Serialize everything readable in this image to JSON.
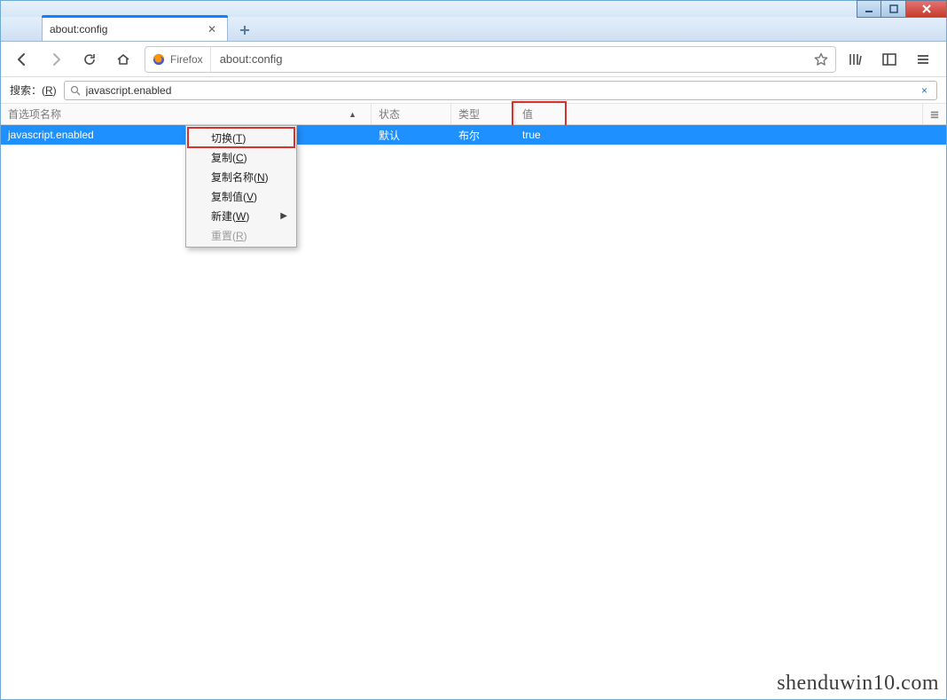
{
  "window": {
    "tab_title": "about:config",
    "identity_label": "Firefox",
    "url": "about:config"
  },
  "search": {
    "label_prefix": "搜索：(",
    "label_key": "R",
    "label_suffix": ")",
    "value": "javascript.enabled",
    "clear_symbol": "×"
  },
  "columns": {
    "name": "首选项名称",
    "status": "状态",
    "type": "类型",
    "value": "值"
  },
  "row": {
    "name": "javascript.enabled",
    "status": "默认",
    "type": "布尔",
    "value": "true"
  },
  "context_menu": {
    "toggle": "切换(",
    "toggle_key": "T",
    "toggle_suf": ")",
    "copy": "复制(",
    "copy_key": "C",
    "copy_suf": ")",
    "copy_name": "复制名称(",
    "copy_name_key": "N",
    "copy_name_suf": ")",
    "copy_value": "复制值(",
    "copy_value_key": "V",
    "copy_value_suf": ")",
    "new": "新建(",
    "new_key": "W",
    "new_suf": ")",
    "reset": "重置(",
    "reset_key": "R",
    "reset_suf": ")"
  },
  "watermark": "shenduwin10.com"
}
